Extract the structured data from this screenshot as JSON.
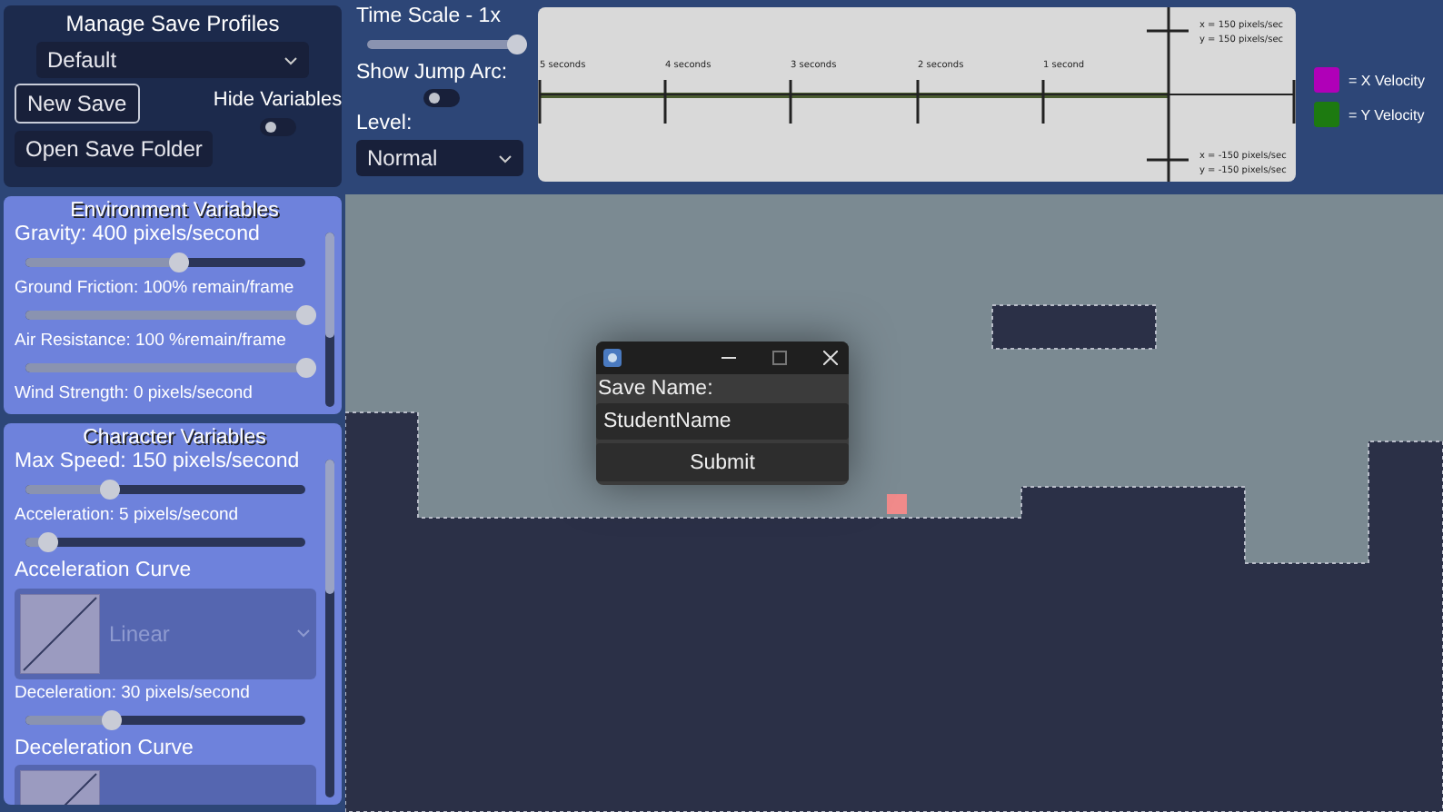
{
  "save_profiles": {
    "title": "Manage Save Profiles",
    "profile": "Default",
    "new_save": "New Save",
    "open_folder": "Open Save Folder",
    "hide_variables": {
      "label": "Hide Variables",
      "on": false
    }
  },
  "controls": {
    "time_scale": {
      "label": "Time Scale - 1x",
      "level": 1
    },
    "jump_arc": {
      "label": "Show Jump Arc:",
      "on": false
    },
    "level": {
      "label": "Level:",
      "value": "Normal"
    }
  },
  "velocity_graph": {
    "time_labels": [
      "5 seconds",
      "4 seconds",
      "3 seconds",
      "2 seconds",
      "1 second"
    ],
    "top_labels": [
      "x = 150 pixels/sec",
      "y = 150 pixels/sec"
    ],
    "bottom_labels": [
      "x = -150 pixels/sec",
      "y = -150 pixels/sec"
    ]
  },
  "legend": [
    {
      "label": "= X Velocity",
      "color": "#b000b8"
    },
    {
      "label": "= Y Velocity",
      "color": "#1d7a10"
    }
  ],
  "environment": {
    "title": "Environment Variables",
    "items": [
      {
        "kind": "slider",
        "label": "Gravity: 400 pixels/second",
        "large": true,
        "level": 0.55
      },
      {
        "kind": "slider",
        "label": "Ground Friction: 100% remain/frame",
        "large": false,
        "level": 1
      },
      {
        "kind": "slider",
        "label": "Air Resistance: 100 %remain/frame",
        "large": false,
        "level": 1
      },
      {
        "kind": "slider",
        "label": "Wind Strength: 0 pixels/second",
        "large": false
      }
    ]
  },
  "character": {
    "title": "Character Variables",
    "items": [
      {
        "kind": "slider",
        "label": "Max Speed: 150 pixels/second",
        "large": true,
        "level": 0.3
      },
      {
        "kind": "slider",
        "label": "Acceleration: 5 pixels/second",
        "large": false,
        "level": 0.08
      },
      {
        "kind": "curve",
        "label": "Acceleration Curve",
        "value": "Linear"
      },
      {
        "kind": "slider",
        "label": "Deceleration: 30 pixels/second",
        "large": false,
        "level": 0.31
      },
      {
        "kind": "curve",
        "label": "Deceleration Curve"
      }
    ]
  },
  "dialog": {
    "label": "Save Name:",
    "value": "StudentName",
    "submit": "Submit"
  }
}
